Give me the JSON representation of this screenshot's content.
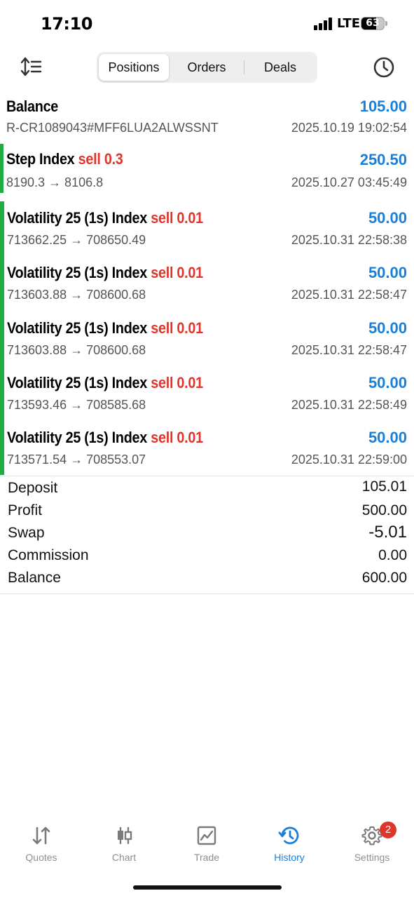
{
  "status_bar": {
    "time": "17:10",
    "network": "LTE",
    "battery": "63"
  },
  "tabs": {
    "positions": "Positions",
    "orders": "Orders",
    "deals": "Deals",
    "active": "positions"
  },
  "balance_row": {
    "title": "Balance",
    "amount": "105.00",
    "reference": "R-CR1089043#MFF6LUA2ALWSSNT",
    "datetime": "2025.10.19 19:02:54"
  },
  "deals": [
    {
      "symbol": "Step Index",
      "side": "sell 0.3",
      "profit": "250.50",
      "prices": "8190.3 → 8106.8",
      "datetime": "2025.10.27 03:45:49"
    },
    {
      "symbol": "Volatility 25 (1s) Index",
      "side": "sell 0.01",
      "profit": "50.00",
      "prices": "713662.25 → 708650.49",
      "datetime": "2025.10.31 22:58:38"
    },
    {
      "symbol": "Volatility 25 (1s) Index",
      "side": "sell 0.01",
      "profit": "50.00",
      "prices": "713603.88 → 708600.68",
      "datetime": "2025.10.31 22:58:47"
    },
    {
      "symbol": "Volatility 25 (1s) Index",
      "side": "sell 0.01",
      "profit": "50.00",
      "prices": "713603.88 → 708600.68",
      "datetime": "2025.10.31 22:58:47"
    },
    {
      "symbol": "Volatility 25 (1s) Index",
      "side": "sell 0.01",
      "profit": "50.00",
      "prices": "713593.46 → 708585.68",
      "datetime": "2025.10.31 22:58:49"
    },
    {
      "symbol": "Volatility 25 (1s) Index",
      "side": "sell 0.01",
      "profit": "50.00",
      "prices": "713571.54 → 708553.07",
      "datetime": "2025.10.31 22:59:00"
    }
  ],
  "summary": [
    {
      "label": "Deposit",
      "value": "105.01"
    },
    {
      "label": "Profit",
      "value": "500.00"
    },
    {
      "label": "Swap",
      "value": "-5.01"
    },
    {
      "label": "Commission",
      "value": "0.00"
    },
    {
      "label": "Balance",
      "value": "600.00"
    }
  ],
  "bottom_nav": {
    "items": [
      {
        "label": "Quotes",
        "icon": "quotes-arrows-icon"
      },
      {
        "label": "Chart",
        "icon": "candlestick-icon"
      },
      {
        "label": "Trade",
        "icon": "trade-chart-icon"
      },
      {
        "label": "History",
        "icon": "history-clock-icon"
      },
      {
        "label": "Settings",
        "icon": "gear-icon"
      }
    ],
    "active": "History",
    "settings_badge": "2"
  },
  "colors": {
    "accent": "#1a7fd9",
    "sell": "#e0352b",
    "position_bar": "#22aa44"
  }
}
